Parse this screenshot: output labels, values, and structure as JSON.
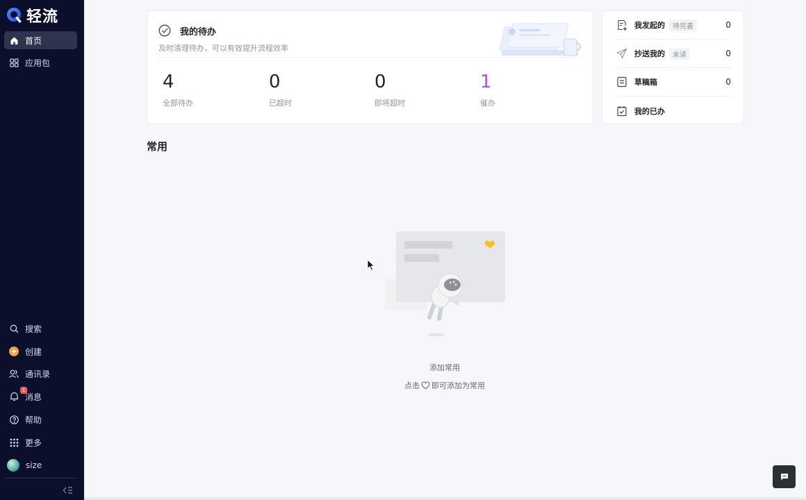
{
  "app": {
    "name": "轻流"
  },
  "sidebar": {
    "top_items": [
      {
        "label": "首页",
        "icon": "home-icon",
        "active": true
      },
      {
        "label": "应用包",
        "icon": "grid-icon",
        "active": false
      }
    ],
    "bottom_items": [
      {
        "label": "搜索",
        "icon": "search-icon"
      },
      {
        "label": "创建",
        "icon": "plus-circle-icon"
      },
      {
        "label": "通讯录",
        "icon": "contacts-icon"
      },
      {
        "label": "消息",
        "icon": "bell-icon",
        "badge": "1"
      },
      {
        "label": "帮助",
        "icon": "help-icon"
      },
      {
        "label": "更多",
        "icon": "apps-icon"
      },
      {
        "label": "size",
        "icon": "avatar"
      }
    ]
  },
  "todo": {
    "title": "我的待办",
    "subtitle": "及时清理待办，可以有效提升流程效率",
    "stats": [
      {
        "value": "4",
        "label": "全部待办"
      },
      {
        "value": "0",
        "label": "已超时"
      },
      {
        "value": "0",
        "label": "即将超时"
      },
      {
        "value": "1",
        "label": "催办",
        "accent": "#b44fd6"
      }
    ]
  },
  "side_panel": {
    "items": [
      {
        "label": "我发起的",
        "tag": "待完善",
        "count": "0",
        "icon": "doc-plus-icon"
      },
      {
        "label": "抄送我的",
        "tag": "未读",
        "count": "0",
        "icon": "send-icon"
      },
      {
        "label": "草稿箱",
        "tag": "",
        "count": "0",
        "icon": "draft-icon"
      },
      {
        "label": "我的已办",
        "tag": "",
        "count": "",
        "icon": "calendar-check-icon"
      }
    ]
  },
  "common": {
    "title": "常用",
    "empty_title": "添加常用",
    "empty_hint_prefix": "点击",
    "empty_hint_suffix": "即可添加为常用"
  },
  "colors": {
    "sidebar_bg": "#0c0f2c",
    "accent_purple": "#b44fd6",
    "logo_blue": "#3a6df0"
  }
}
